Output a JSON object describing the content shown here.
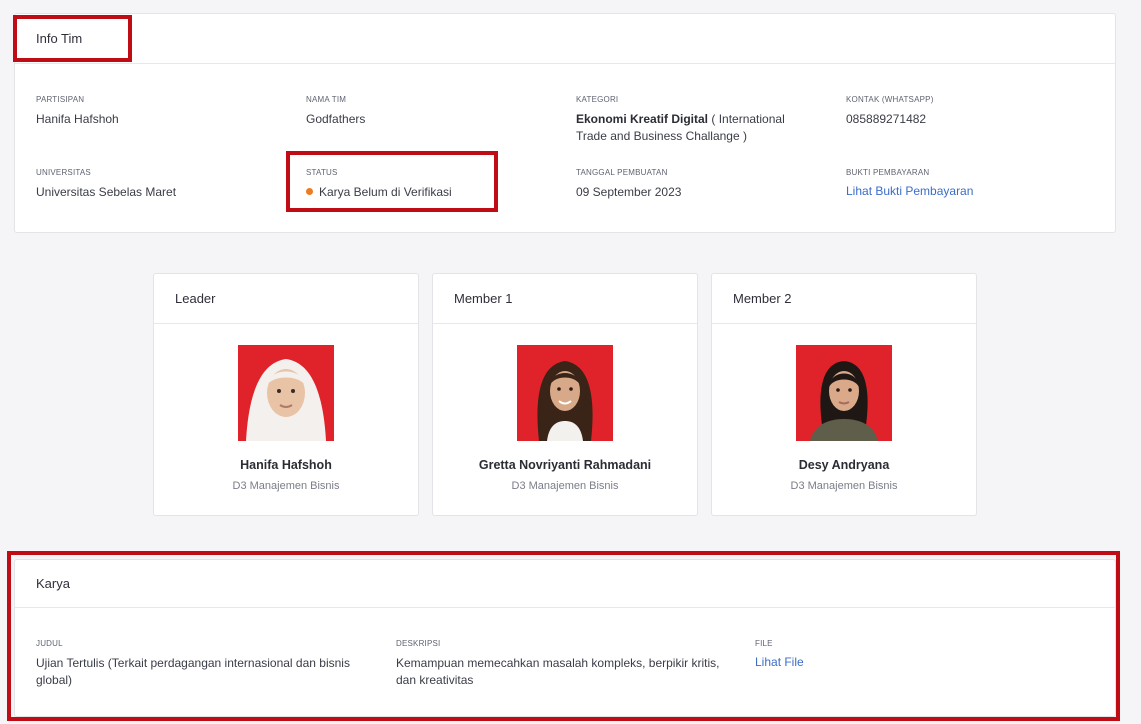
{
  "info": {
    "title": "Info Tim",
    "fields": {
      "partisipan": {
        "label": "PARTISIPAN",
        "value": "Hanifa Hafshoh"
      },
      "nama_tim": {
        "label": "NAMA TIM",
        "value": "Godfathers"
      },
      "kategori": {
        "label": "KATEGORI",
        "value_bold": "Ekonomi Kreatif Digital",
        "value_rest": " ( International Trade and Business Challange )"
      },
      "kontak": {
        "label": "KONTAK (WHATSAPP)",
        "value": "085889271482"
      },
      "universitas": {
        "label": "UNIVERSITAS",
        "value": "Universitas Sebelas Maret"
      },
      "status": {
        "label": "STATUS",
        "value": "Karya Belum di Verifikasi",
        "dot_color": "#ee7b22"
      },
      "tanggal": {
        "label": "TANGGAL PEMBUATAN",
        "value": "09 September 2023"
      },
      "bukti": {
        "label": "BUKTI PEMBAYARAN",
        "link": "Lihat Bukti Pembayaran"
      }
    }
  },
  "members": [
    {
      "role": "Leader",
      "name": "Hanifa Hafshoh",
      "program": "D3 Manajemen Bisnis"
    },
    {
      "role": "Member 1",
      "name": "Gretta Novriyanti Rahmadani",
      "program": "D3 Manajemen Bisnis"
    },
    {
      "role": "Member 2",
      "name": "Desy Andryana",
      "program": "D3 Manajemen Bisnis"
    }
  ],
  "karya": {
    "title": "Karya",
    "judul": {
      "label": "JUDUL",
      "value": "Ujian Tertulis (Terkait perdagangan internasional dan bisnis global)"
    },
    "deskripsi": {
      "label": "DESKRIPSI",
      "value": "Kemampuan memecahkan masalah kompleks, berpikir kritis, dan kreativitas"
    },
    "file": {
      "label": "FILE",
      "link": "Lihat File"
    }
  },
  "colors": {
    "link": "#3b6dc9",
    "highlight": "#c00d15",
    "photo_bg": "#e0232a"
  }
}
